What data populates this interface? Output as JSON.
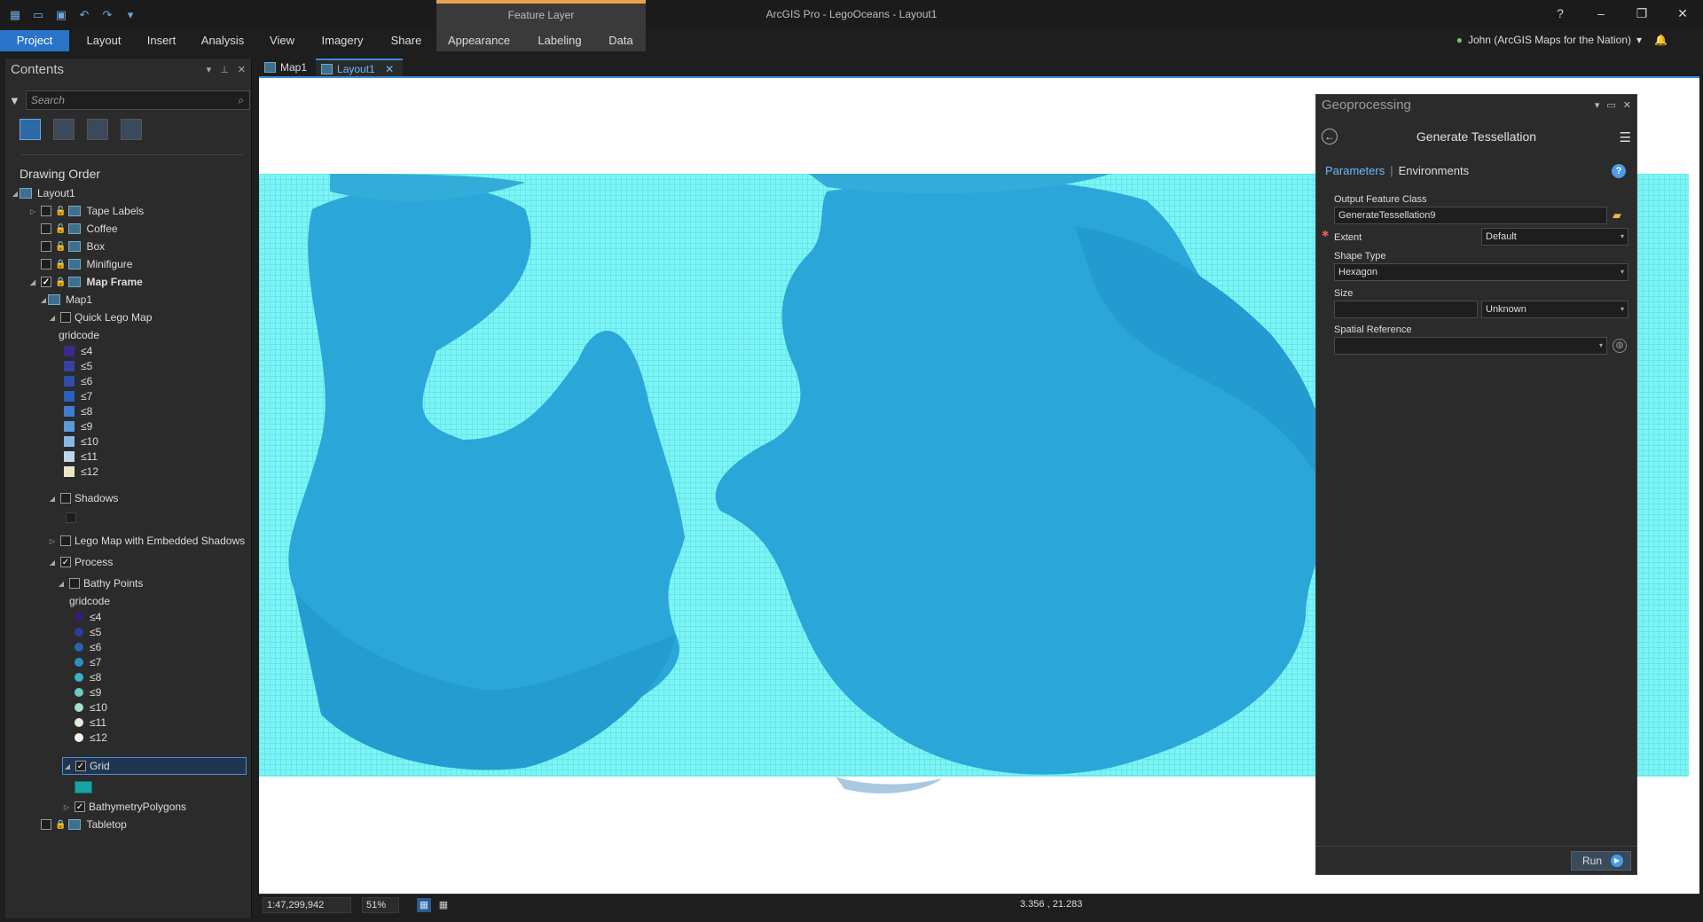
{
  "app": {
    "title": "ArcGIS Pro - LegoOceans - Layout1",
    "context_group": "Feature Layer",
    "help": "?",
    "user": "John (ArcGIS Maps for the Nation)"
  },
  "ribbon": {
    "tabs": [
      "Project",
      "Layout",
      "Insert",
      "Analysis",
      "View",
      "Imagery",
      "Share",
      "Appearance",
      "Labeling",
      "Data"
    ]
  },
  "contents": {
    "title": "Contents",
    "search_placeholder": "Search",
    "drawing_order": "Drawing Order",
    "rows": [
      {
        "label": "Layout1"
      },
      {
        "label": "Tape Labels"
      },
      {
        "label": "Coffee"
      },
      {
        "label": "Box"
      },
      {
        "label": "Minifigure"
      },
      {
        "label": "Map Frame"
      },
      {
        "label": "Map1"
      },
      {
        "label": "Quick Lego Map"
      },
      {
        "label": "gridcode"
      },
      {
        "label": "Shadows"
      },
      {
        "label": "Lego Map with Embedded Shadows"
      },
      {
        "label": "Process"
      },
      {
        "label": "Bathy Points"
      },
      {
        "label": "gridcode"
      },
      {
        "label": "Grid"
      },
      {
        "label": "BathymetryPolygons"
      },
      {
        "label": "Tabletop"
      }
    ],
    "legend_quick": [
      {
        "label": "≤4",
        "color": "#3b2a8a"
      },
      {
        "label": "≤5",
        "color": "#3a3fa6"
      },
      {
        "label": "≤6",
        "color": "#2d4fa8"
      },
      {
        "label": "≤7",
        "color": "#2a5fc0"
      },
      {
        "label": "≤8",
        "color": "#3f7ed0"
      },
      {
        "label": "≤9",
        "color": "#5a9ad8"
      },
      {
        "label": "≤10",
        "color": "#86b9e6"
      },
      {
        "label": "≤11",
        "color": "#bcd8ee"
      },
      {
        "label": "≤12",
        "color": "#ece6c6"
      }
    ],
    "legend_bathy": [
      {
        "label": "≤4",
        "color": "#3a1a7a"
      },
      {
        "label": "≤5",
        "color": "#2e3d9a"
      },
      {
        "label": "≤6",
        "color": "#2a62ad"
      },
      {
        "label": "≤7",
        "color": "#2b8fc3"
      },
      {
        "label": "≤8",
        "color": "#3bb0c8"
      },
      {
        "label": "≤9",
        "color": "#6ccbc2"
      },
      {
        "label": "≤10",
        "color": "#a6e0c8"
      },
      {
        "label": "≤11",
        "color": "#dcefd6"
      },
      {
        "label": "≤12",
        "color": "#f6f6ee"
      }
    ],
    "shadow_swatch": "#1e1e1e",
    "grid_swatch": "#1aa3a3"
  },
  "tabs": {
    "map1": "Map1",
    "layout1": "Layout1"
  },
  "status": {
    "scale": "1:47,299,942",
    "zoom": "51%",
    "coords": "3.356 , 21.283"
  },
  "geoprocessing": {
    "title": "Geoprocessing",
    "tool": "Generate Tessellation",
    "tab_parameters": "Parameters",
    "tab_environments": "Environments",
    "output_label": "Output Feature Class",
    "output_value": "GenerateTessellation9",
    "extent_label": "Extent",
    "extent_value": "Default",
    "shape_label": "Shape Type",
    "shape_value": "Hexagon",
    "size_label": "Size",
    "size_value": "",
    "size_unit": "Unknown",
    "sr_label": "Spatial Reference",
    "sr_value": "",
    "run": "Run"
  },
  "colors": {
    "accent": "#2a73c9",
    "ocean_grid": "#7df4f5",
    "continent": "#2aa6d8"
  }
}
